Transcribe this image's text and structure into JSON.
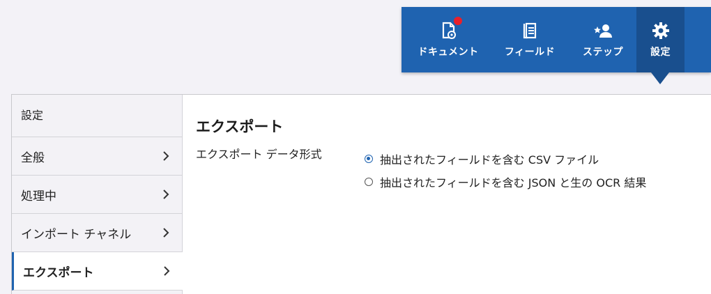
{
  "toolbar": {
    "items": [
      {
        "label": "ドキュメント",
        "icon": "document-gear-icon",
        "notification": true
      },
      {
        "label": "フィールド",
        "icon": "fields-icon"
      },
      {
        "label": "ステップ",
        "icon": "person-star-icon"
      },
      {
        "label": "設定",
        "icon": "gear-icon",
        "active": true
      }
    ]
  },
  "sidebar": {
    "header": "設定",
    "items": [
      {
        "label": "全般"
      },
      {
        "label": "処理中"
      },
      {
        "label": "インポート チャネル"
      },
      {
        "label": "エクスポート",
        "active": true
      }
    ]
  },
  "content": {
    "title": "エクスポート",
    "field_label": "エクスポート データ形式",
    "options": [
      {
        "label": "抽出されたフィールドを含む CSV ファイル",
        "selected": true
      },
      {
        "label": "抽出されたフィールドを含む JSON と生の OCR 結果",
        "selected": false
      }
    ]
  },
  "colors": {
    "toolbar": "#1f63b0",
    "toolbar_active": "#194f8e",
    "notification": "#e8202b"
  }
}
